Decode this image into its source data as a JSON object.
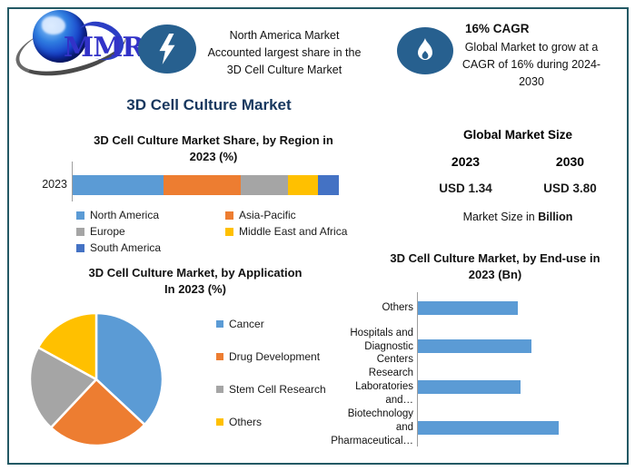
{
  "frame": {
    "border_color": "#235964"
  },
  "header": {
    "logo_text": "MMR",
    "north_america_note": {
      "lines": [
        "North America Market",
        "Accounted largest share in the",
        "3D Cell Culture Market"
      ]
    },
    "cagr_note": {
      "title": "16% CAGR",
      "lines": [
        "Global Market to grow at a",
        "CAGR of 16% during 2024-",
        "2030"
      ]
    }
  },
  "main_title": "3D Cell Culture Market",
  "market_size": {
    "title": "Global Market Size",
    "year_left": "2023",
    "year_right": "2030",
    "value_left": "USD 1.34",
    "value_right": "USD 3.80",
    "value_color": "#1B86CA",
    "note_prefix": "Market Size in ",
    "note_bold": "Billion"
  },
  "chart_data": [
    {
      "type": "bar",
      "variant": "stacked-horizontal",
      "title": "3D Cell Culture Market Share, by Region in 2023 (%)",
      "title_lines": [
        "3D Cell Culture Market Share, by Region in",
        "2023 (%)"
      ],
      "categories": [
        "2023"
      ],
      "series": [
        {
          "name": "North America",
          "color": "#5B9BD5",
          "values": [
            34
          ]
        },
        {
          "name": "Asia-Pacific",
          "color": "#ED7D31",
          "values": [
            29
          ]
        },
        {
          "name": "Europe",
          "color": "#A5A5A5",
          "values": [
            18
          ]
        },
        {
          "name": "Middle East and Africa",
          "color": "#FFC000",
          "values": [
            11
          ]
        },
        {
          "name": "South America",
          "color": "#4472C4",
          "values": [
            8
          ]
        }
      ],
      "xlim": [
        0,
        100
      ],
      "legend_position": "bottom"
    },
    {
      "type": "pie",
      "title": "3D Cell Culture Market, by Application In 2023 (%)",
      "title_lines": [
        "3D Cell Culture Market, by Application",
        "In 2023 (%)"
      ],
      "labels": [
        "Cancer",
        "Drug Development",
        "Stem Cell Research",
        "Others"
      ],
      "values": [
        37,
        25,
        21,
        17
      ],
      "colors": [
        "#5B9BD5",
        "#ED7D31",
        "#A5A5A5",
        "#FFC000"
      ],
      "start_angle_deg": 0,
      "legend_position": "right"
    },
    {
      "type": "bar",
      "variant": "horizontal",
      "title": "3D Cell Culture Market, by End-use in 2023 (Bn)",
      "title_lines": [
        "3D Cell Culture Market, by End-use in",
        "2023 (Bn)"
      ],
      "categories": [
        "Others",
        "Hospitals and Diagnostic Centers",
        "Research Laboratories and…",
        "Biotechnology and Pharmaceutical…"
      ],
      "categories_lines": [
        [
          "Others"
        ],
        [
          "Hospitals and",
          "Diagnostic Centers"
        ],
        [
          "Research",
          "Laboratories and…"
        ],
        [
          "Biotechnology and",
          "Pharmaceutical…"
        ]
      ],
      "values": [
        0.29,
        0.33,
        0.3,
        0.41
      ],
      "xlim": [
        0,
        0.45
      ],
      "bar_color": "#5B9BD5",
      "grid": false
    }
  ]
}
